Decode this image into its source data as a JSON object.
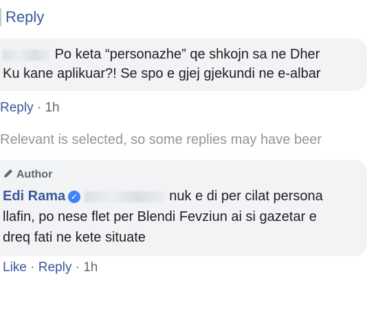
{
  "top": {
    "reply_label": "Reply"
  },
  "comment1": {
    "line1": "Po keta “personazhe” qe shkojn sa ne Dher",
    "line2": "Ku kane aplikuar?! Se spo e gjej gjekundi ne e-albar",
    "reply_label": "Reply",
    "time": "1h"
  },
  "notice": "Relevant is selected, so some replies may have beer",
  "author_comment": {
    "badge_label": "Author",
    "author_name": "Edi Rama",
    "line1_text": "nuk e di per cilat persona",
    "line2": "llafin, po nese flet per Blendi Fevziun ai si gazetar e",
    "line3": "dreq fati ne kete situate",
    "like_label": "Like",
    "reply_label": "Reply",
    "time": "1h"
  },
  "colors": {
    "link": "#385898",
    "bubble": "#f2f3f5",
    "verified": "#4080ff"
  }
}
